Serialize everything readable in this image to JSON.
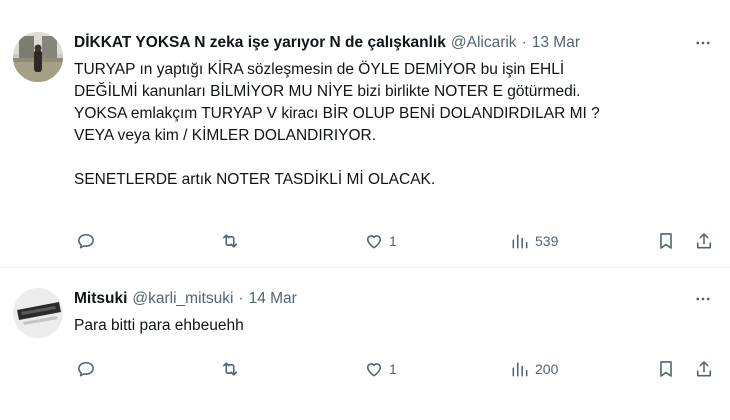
{
  "tweets": [
    {
      "author_name": "DİKKAT YOKSA N zeka işe yarıyor N de çalışkanlık",
      "handle": "@Alicarik",
      "separator": "·",
      "date": "13 Mar",
      "text_lines": [
        "TURYAP ın yaptığı KİRA sözleşmesin de ÖYLE DEMİYOR bu işin EHLİ",
        "DEĞİLMİ  kanunları BİLMİYOR MU NİYE bizi birlikte NOTER E götürmedi.",
        "YOKSA emlakçım TURYAP  V kiracı BİR OLUP BENİ DOLANDIRDILAR MI ?",
        "VEYA veya kim  / KİMLER DOLANDIRIYOR.",
        "",
        "SENETLERDE artık NOTER TASDİKLİ Mİ OLACAK."
      ],
      "replies": "",
      "reposts": "",
      "likes": "1",
      "views": "539"
    },
    {
      "author_name": "Mitsuki",
      "handle": "@karli_mitsuki",
      "separator": "·",
      "date": "14 Mar",
      "text_lines": [
        "Para bitti para ehbeuehh"
      ],
      "replies": "",
      "reposts": "",
      "likes": "1",
      "views": "200"
    }
  ],
  "colors": {
    "text": "#0f1419",
    "secondary": "#536471",
    "divider": "#eff3f4",
    "background": "#ffffff"
  },
  "icons": [
    "more-icon",
    "reply-icon",
    "repost-icon",
    "like-icon",
    "views-icon",
    "bookmark-icon",
    "share-icon"
  ]
}
